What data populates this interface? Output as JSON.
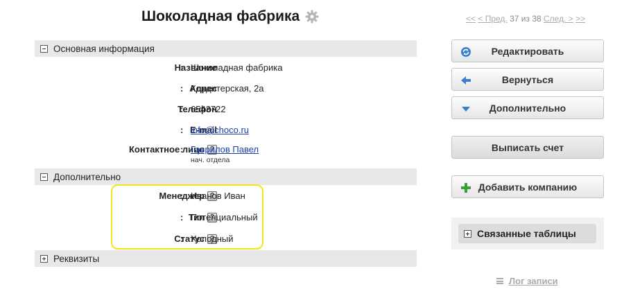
{
  "title": "Шоколадная фабрика",
  "pager": {
    "first": "<<",
    "prev": "< Пред.",
    "count": "37 из 38",
    "next": "След. >",
    "last": ">>"
  },
  "sections": {
    "main": "Основная информация",
    "extra": "Дополнительно",
    "requisites": "Реквизиты"
  },
  "fields": {
    "name": {
      "label": "Название",
      "value": "Шоколадная фабрика"
    },
    "address": {
      "label": "Адрес",
      "value": "Кондитерская, 2а"
    },
    "phone": {
      "label": "Телефон",
      "value": "6543722"
    },
    "email": {
      "label": "E-mail",
      "value": "info@choco.ru"
    },
    "contact": {
      "label": "Контактное лицо",
      "value": "Гаврилов Павел",
      "sub": "нач. отдела"
    },
    "manager": {
      "label": "Менеджер",
      "value": "Иванов Иван"
    },
    "type": {
      "label": "Тип",
      "value": "Потенциальный"
    },
    "status": {
      "label": "Статус",
      "value": "Холодный"
    }
  },
  "colon": ":",
  "help_glyph": "?",
  "buttons": {
    "edit": "Редактировать",
    "back": "Вернуться",
    "more": "Дополнительно",
    "invoice": "Выписать счет",
    "add_company": "Добавить компанию"
  },
  "related": "Связанные таблицы",
  "log": "Лог записи",
  "colors": {
    "highlight": "#f2e61a",
    "link": "#1a3fb0",
    "add_green": "#3aa02c",
    "arrow_blue": "#3b7fd0"
  }
}
